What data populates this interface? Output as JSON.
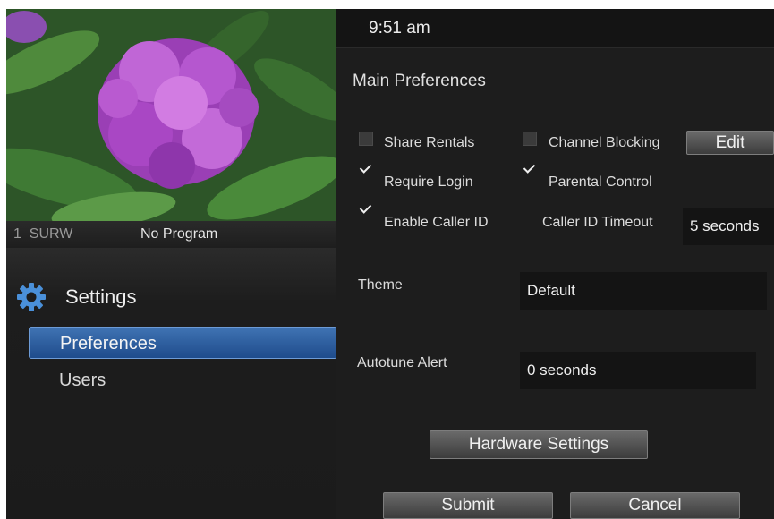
{
  "player": {
    "channel_number": "1",
    "channel_name": "SURW",
    "program": "No Program"
  },
  "topbar": {
    "time": "9:51 am"
  },
  "sidebar": {
    "title": "Settings",
    "items": [
      {
        "label": "Preferences",
        "selected": true
      },
      {
        "label": "Users",
        "selected": false
      }
    ]
  },
  "main": {
    "section_title": "Main Preferences",
    "share_rentals": {
      "label": "Share Rentals",
      "checked": false
    },
    "channel_blocking": {
      "label": "Channel Blocking",
      "checked": false
    },
    "edit_button": "Edit",
    "require_login": {
      "label": "Require Login",
      "checked": true
    },
    "parental_control": {
      "label": "Parental Control",
      "checked": true
    },
    "enable_caller_id": {
      "label": "Enable Caller ID",
      "checked": true
    },
    "caller_id_timeout": {
      "label": "Caller ID Timeout",
      "value": "5 seconds"
    },
    "theme": {
      "label": "Theme",
      "value": "Default"
    },
    "autotune_alert": {
      "label": "Autotune Alert",
      "value": "0 seconds"
    },
    "hardware_settings_button": "Hardware Settings",
    "submit_button": "Submit",
    "cancel_button": "Cancel"
  },
  "colors": {
    "background": "#1b1b1b",
    "selection": "#2f609f",
    "button": "#555555",
    "gear_icon": "#4a90d9"
  }
}
